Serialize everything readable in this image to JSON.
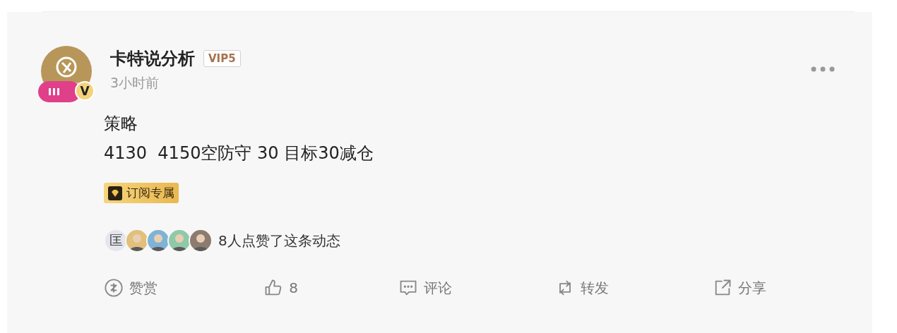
{
  "post": {
    "author": "卡特说分析",
    "vip": "VIP5",
    "live_badge": "V",
    "time": "3小时前",
    "lines": [
      "策略",
      "4130  4150空防守 30 目标30减仓"
    ],
    "tag": "订阅专属"
  },
  "likes": {
    "avatars": [
      {
        "kind": "text",
        "text": "匡"
      },
      {
        "kind": "picture"
      },
      {
        "kind": "picture"
      },
      {
        "kind": "picture"
      },
      {
        "kind": "picture"
      }
    ],
    "summary": "8人点赞了这条动态"
  },
  "actions": [
    {
      "kind": "reward",
      "label": "赞赏"
    },
    {
      "kind": "like",
      "label": "8"
    },
    {
      "kind": "comment",
      "label": "评论"
    },
    {
      "kind": "repost",
      "label": "转发"
    },
    {
      "kind": "share",
      "label": "分享"
    }
  ]
}
